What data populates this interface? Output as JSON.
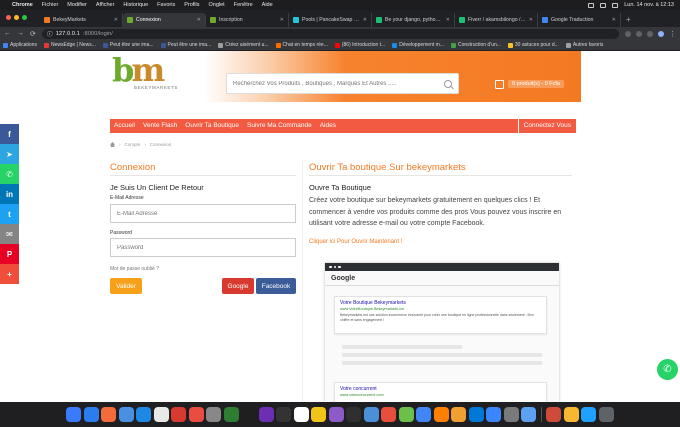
{
  "mac_menu": {
    "apple": "",
    "app": "Chrome",
    "items": [
      "Fichier",
      "Modifier",
      "Afficher",
      "Historique",
      "Favoris",
      "Profils",
      "Onglet",
      "Fenêtre",
      "Aide"
    ],
    "clock": "Lun. 14 nov. à 12:13"
  },
  "tabs": [
    {
      "title": "BekeyMarkets",
      "color": "#f47a22",
      "active": false
    },
    {
      "title": "Connexion",
      "color": "#6eaa2b",
      "active": true
    },
    {
      "title": "Inscription",
      "color": "#6eaa2b",
      "active": false
    },
    {
      "title": "Pools | PancakeSwap - $...",
      "color": "#26c6da",
      "active": false
    },
    {
      "title": "Be your django, python b...",
      "color": "#1dbf73",
      "active": false
    },
    {
      "title": "Fiverr / akamsbilongo / B...",
      "color": "#1dbf73",
      "active": false
    },
    {
      "title": "Google Traduction",
      "color": "#4285f4",
      "active": false
    }
  ],
  "address_bar": {
    "url_host": "127.0.0.1",
    "url_path": ":8000/login/"
  },
  "bookmarks": [
    "Applications",
    "NewsEdge | News...",
    "Peut être une ima...",
    "Peut être une ima...",
    "Créez aisément u...",
    "Chat en temps rée...",
    "(86) Introduction t...",
    "Développement m...",
    "Construction d'un...",
    "30 astuces pour d...",
    "Autres favoris"
  ],
  "site": {
    "logo_text": "bm",
    "logo_sub": "BEKEYMARKETS",
    "search_placeholder": "Recherchez Vos Produits , Boutiques , Marques Et Autres .....",
    "cart_label": "0 produit(s) - 0 Fcfa",
    "nav": [
      "Accueil",
      "Vente Flash",
      "Ouvrir Ta Boutique",
      "Suivre Ma Commande",
      "Aides"
    ],
    "nav_right": "Connectez Vous",
    "breadcrumb": [
      "Compte",
      "Connexion"
    ]
  },
  "social": [
    {
      "icon": "facebook-icon",
      "glyph": "f",
      "color": "#3b5998"
    },
    {
      "icon": "telegram-icon",
      "glyph": "➤",
      "color": "#2ca5e0"
    },
    {
      "icon": "whatsapp-icon",
      "glyph": "✆",
      "color": "#25d366"
    },
    {
      "icon": "linkedin-icon",
      "glyph": "in",
      "color": "#0077b5"
    },
    {
      "icon": "twitter-icon",
      "glyph": "t",
      "color": "#1da1f2"
    },
    {
      "icon": "email-icon",
      "glyph": "✉",
      "color": "#848484"
    },
    {
      "icon": "pinterest-icon",
      "glyph": "P",
      "color": "#e60023"
    },
    {
      "icon": "more-icon",
      "glyph": "+",
      "color": "#f04e3a"
    }
  ],
  "login": {
    "title": "Connexion",
    "subtitle": "Je Suis Un Client De Retour",
    "email_label": "E-Mail Adresse",
    "email_placeholder": "E-Mail Adresse",
    "password_label": "Password",
    "password_placeholder": "Password",
    "forgot": "Mot de passe oublié ?",
    "submit": "Valider",
    "google": "Google",
    "facebook": "Facebook"
  },
  "shop": {
    "title": "Ouvrir Ta boutique Sur bekeymarkets",
    "subtitle": "Ouvre Ta Boutique",
    "description": "Créez votre boutique sur bekeymarkets gratuitement en quelques clics ! Et commencer à vendre vos produits comme des pros Vous pouvez vous inscrire en utilisant votre adresse e-mail ou votre compte Facebook.",
    "link": "Cliquer ici Pour Ouvrir Maintenant !",
    "mock": {
      "google": "Google",
      "card1_title": "Votre Boutique Bekeymarkets",
      "card1_url": "www.VotreBoutique.Bekeymarkets.cm",
      "card1_desc": "Bekeymarkets est une solution ecommerce innovante pour créer une boutique en ligne professionnelle dans seulement : Bon chiffre et sans engagement !",
      "card2_title": "Votre concurrent",
      "card2_url": "www.votreconcurrent.com"
    }
  },
  "dock_colors": [
    "#3a7afe",
    "#2b7ded",
    "#f26b3a",
    "#4a90e2",
    "#1e88e5",
    "#e8e8e8",
    "#d93a2f",
    "#ea4c42",
    "#888888",
    "#2f7d32",
    "#1f1f1f",
    "#6b2fb3",
    "#333333",
    "#ffffff",
    "#f0c419",
    "#8e5ac8",
    "#2f2f2f",
    "#4a90d9",
    "#e94e3c",
    "#6cc04a",
    "#4285f4",
    "#ff7f00",
    "#f0a030",
    "#0078d7",
    "#3a86ff",
    "#7a7a7a",
    "#5ca0f0",
    "#d04a3a",
    "#f7b731",
    "#1fa2ff",
    "#5f6368"
  ]
}
